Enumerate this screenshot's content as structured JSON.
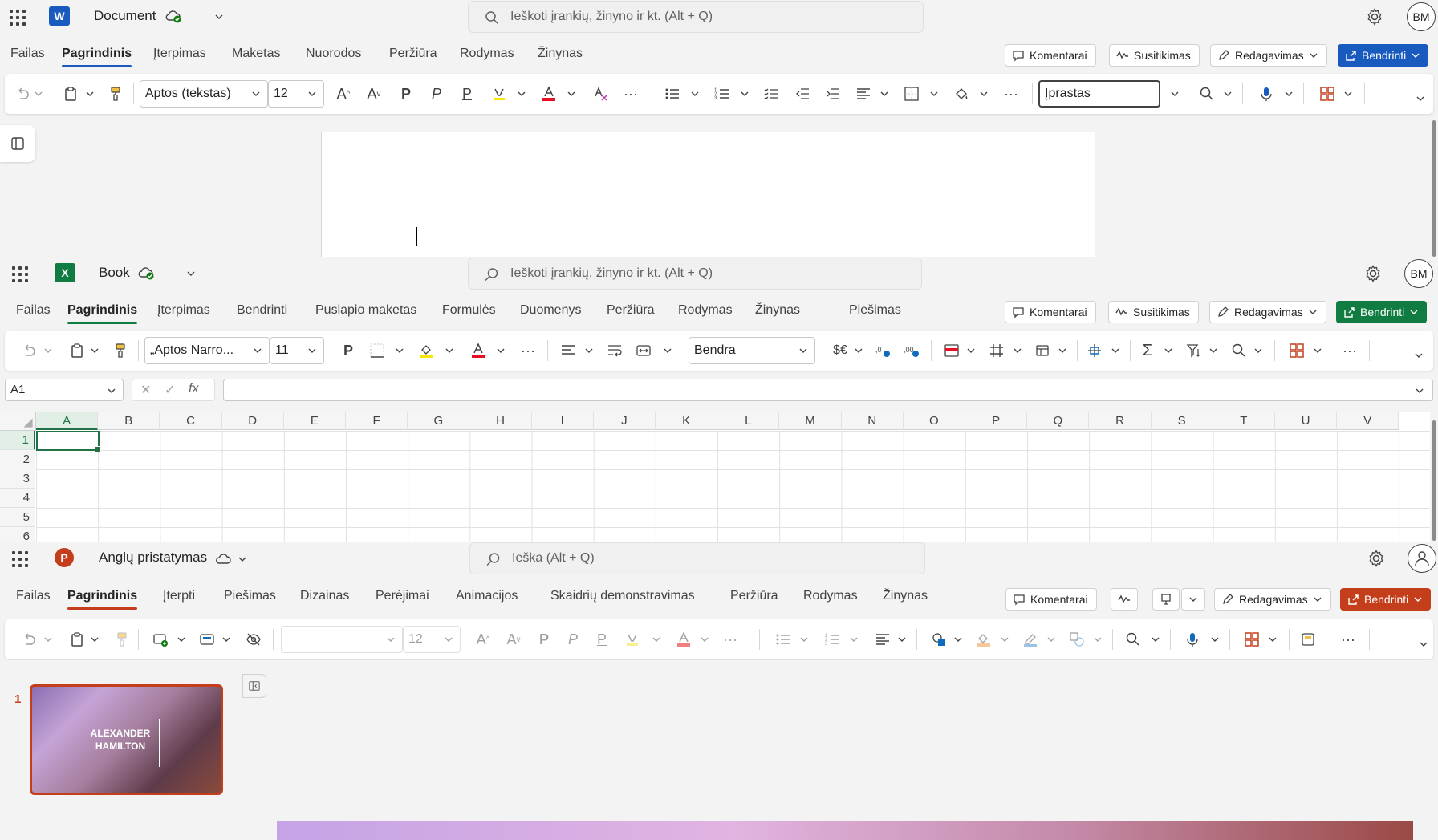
{
  "word": {
    "app_logo_letter": "W",
    "doc_title": "Document",
    "search_placeholder": "Ieškoti įrankių, žinyno ir kt. (Alt + Q)",
    "avatar_initials": "BM",
    "accent": "#185abd",
    "tabs": [
      "Failas",
      "Pagrindinis",
      "Įterpimas",
      "Maketas",
      "Nuorodos",
      "Peržiūra",
      "Rodymas",
      "Žinynas"
    ],
    "active_tab": "Pagrindinis",
    "buttons": {
      "comments": "Komentarai",
      "meeting": "Susitikimas",
      "editing": "Redagavimas",
      "share": "Bendrinti"
    },
    "font_name": "Aptos (tekstas)",
    "font_size": "12",
    "bold_glyph": "P",
    "italic_glyph": "P",
    "underline_glyph": "P",
    "style_value": "Įprastas"
  },
  "excel": {
    "app_logo_letter": "X",
    "doc_title": "Book",
    "search_placeholder": "Ieškoti įrankių, žinyno ir kt. (Alt + Q)",
    "avatar_initials": "BM",
    "accent": "#107c41",
    "tabs": [
      "Failas",
      "Pagrindinis",
      "Įterpimas",
      "Bendrinti",
      "Puslapio maketas",
      "Formulės",
      "Duomenys",
      "Peržiūra",
      "Rodymas",
      "Žinynas",
      "Piešimas"
    ],
    "active_tab": "Pagrindinis",
    "buttons": {
      "comments": "Komentarai",
      "meeting": "Susitikimas",
      "editing": "Redagavimas",
      "share": "Bendrinti"
    },
    "font_name": "„Aptos Narro...",
    "font_size": "11",
    "bold_glyph": "P",
    "number_format": "Bendra",
    "currency_glyph": "$€",
    "name_box": "A1",
    "fx_label": "fx",
    "columns": [
      "A",
      "B",
      "C",
      "D",
      "E",
      "F",
      "G",
      "H",
      "I",
      "J",
      "K",
      "L",
      "M",
      "N",
      "O",
      "P",
      "Q",
      "R",
      "S",
      "T",
      "U",
      "V"
    ],
    "rows": [
      "1",
      "2",
      "3",
      "4",
      "5",
      "6"
    ]
  },
  "ppt": {
    "app_logo_letter": "P",
    "doc_title": "Anglų pristatymas",
    "search_placeholder": "Ieška (Alt + Q)",
    "accent": "#c43e1c",
    "tabs": [
      "Failas",
      "Pagrindinis",
      "Įterpti",
      "Piešimas",
      "Dizainas",
      "Perėjimai",
      "Animacijos",
      "Skaidrių demonstravimas",
      "Peržiūra",
      "Rodymas",
      "Žinynas"
    ],
    "active_tab": "Pagrindinis",
    "buttons": {
      "comments": "Komentarai",
      "editing": "Redagavimas",
      "share": "Bendrinti"
    },
    "font_size": "12",
    "bold_glyph": "P",
    "slide_number": "1",
    "slide_title": "ALEXANDER HAMILTON"
  }
}
